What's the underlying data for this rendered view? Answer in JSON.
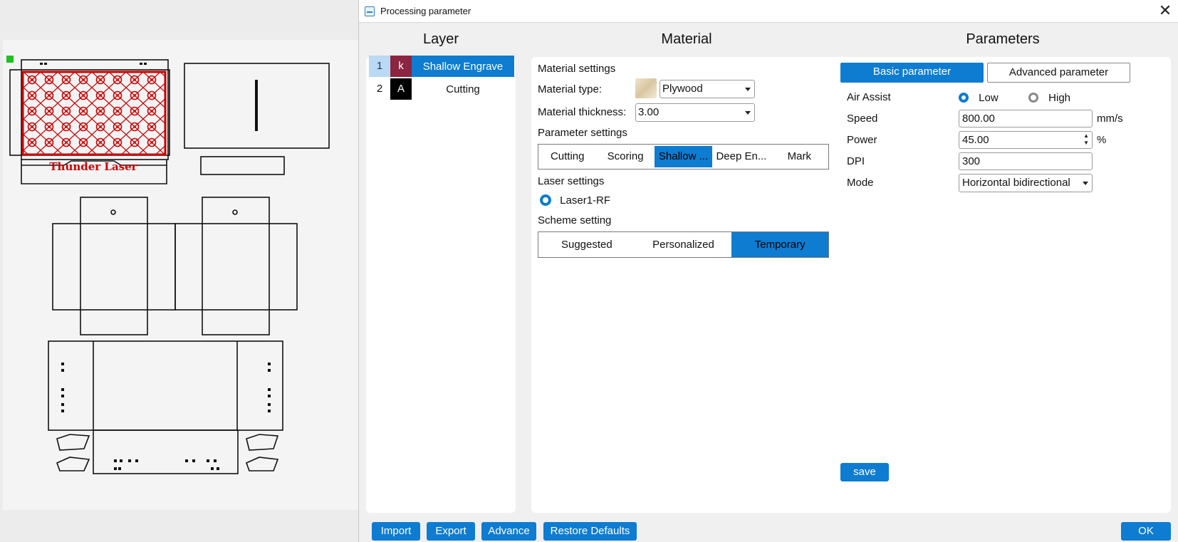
{
  "dialog": {
    "title": "Processing parameter"
  },
  "columns": {
    "layer": "Layer",
    "material": "Material",
    "parameters": "Parameters"
  },
  "layers": [
    {
      "num": "1",
      "swatch": "k",
      "swatch_color": "#8b2540",
      "name": "Shallow Engrave",
      "selected": true
    },
    {
      "num": "2",
      "swatch": "A",
      "swatch_color": "#000000",
      "name": "Cutting",
      "selected": false
    }
  ],
  "material": {
    "settings_heading": "Material settings",
    "type_label": "Material type:",
    "type_value": "Plywood",
    "thickness_label": "Material thickness:",
    "thickness_value": "3.00",
    "param_heading": "Parameter settings",
    "param_tabs": [
      "Cutting",
      "Scoring",
      "Shallow ...",
      "Deep En...",
      "Mark"
    ],
    "param_active": 2,
    "laser_heading": "Laser settings",
    "laser_option": "Laser1-RF",
    "scheme_heading": "Scheme setting",
    "scheme_tabs": [
      "Suggested",
      "Personalized",
      "Temporary"
    ],
    "scheme_active": 2
  },
  "parameters": {
    "tab_basic": "Basic parameter",
    "tab_advanced": "Advanced parameter",
    "air_assist_label": "Air Assist",
    "air_low": "Low",
    "air_high": "High",
    "speed_label": "Speed",
    "speed_value": "800.00",
    "speed_unit": "mm/s",
    "power_label": "Power",
    "power_value": "45.00",
    "power_unit": "%",
    "dpi_label": "DPI",
    "dpi_value": "300",
    "mode_label": "Mode",
    "mode_value": "Horizontal bidirectional",
    "save_label": "save"
  },
  "footer": {
    "import": "Import",
    "export": "Export",
    "advance": "Advance",
    "restore": "Restore Defaults",
    "ok": "OK"
  },
  "canvas": {
    "engraving_text": "Thunder Laser"
  },
  "colors": {
    "accent": "#0e7cd0",
    "engrave": "#cc0000"
  }
}
